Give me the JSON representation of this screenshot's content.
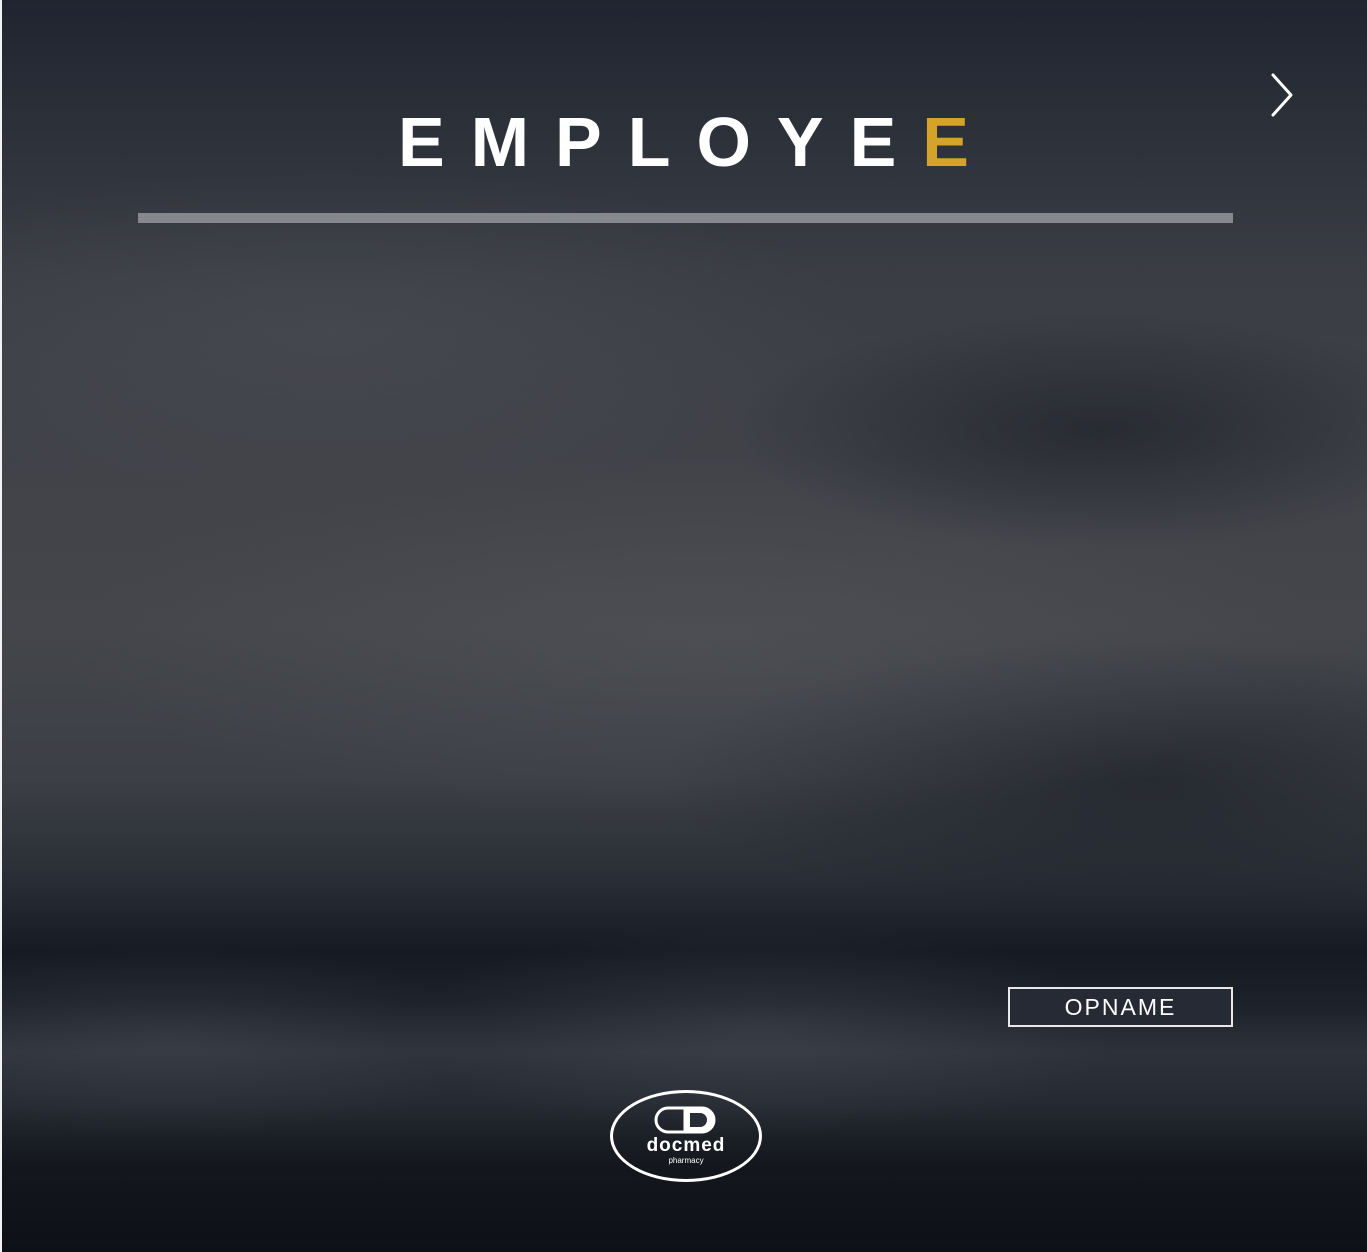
{
  "header": {
    "title_main": "EMPLOYE",
    "title_accent": "E"
  },
  "actions": {
    "opname_label": "OPNAME"
  },
  "logo": {
    "name": "docmed",
    "tagline": "pharmacy"
  },
  "icons": {
    "next": "chevron-right-icon",
    "logo_mark": "capsule-icon"
  },
  "colors": {
    "accent": "#d4a32a",
    "text": "#ffffff",
    "divider": "#85888d",
    "button_bg": "#252a34"
  }
}
